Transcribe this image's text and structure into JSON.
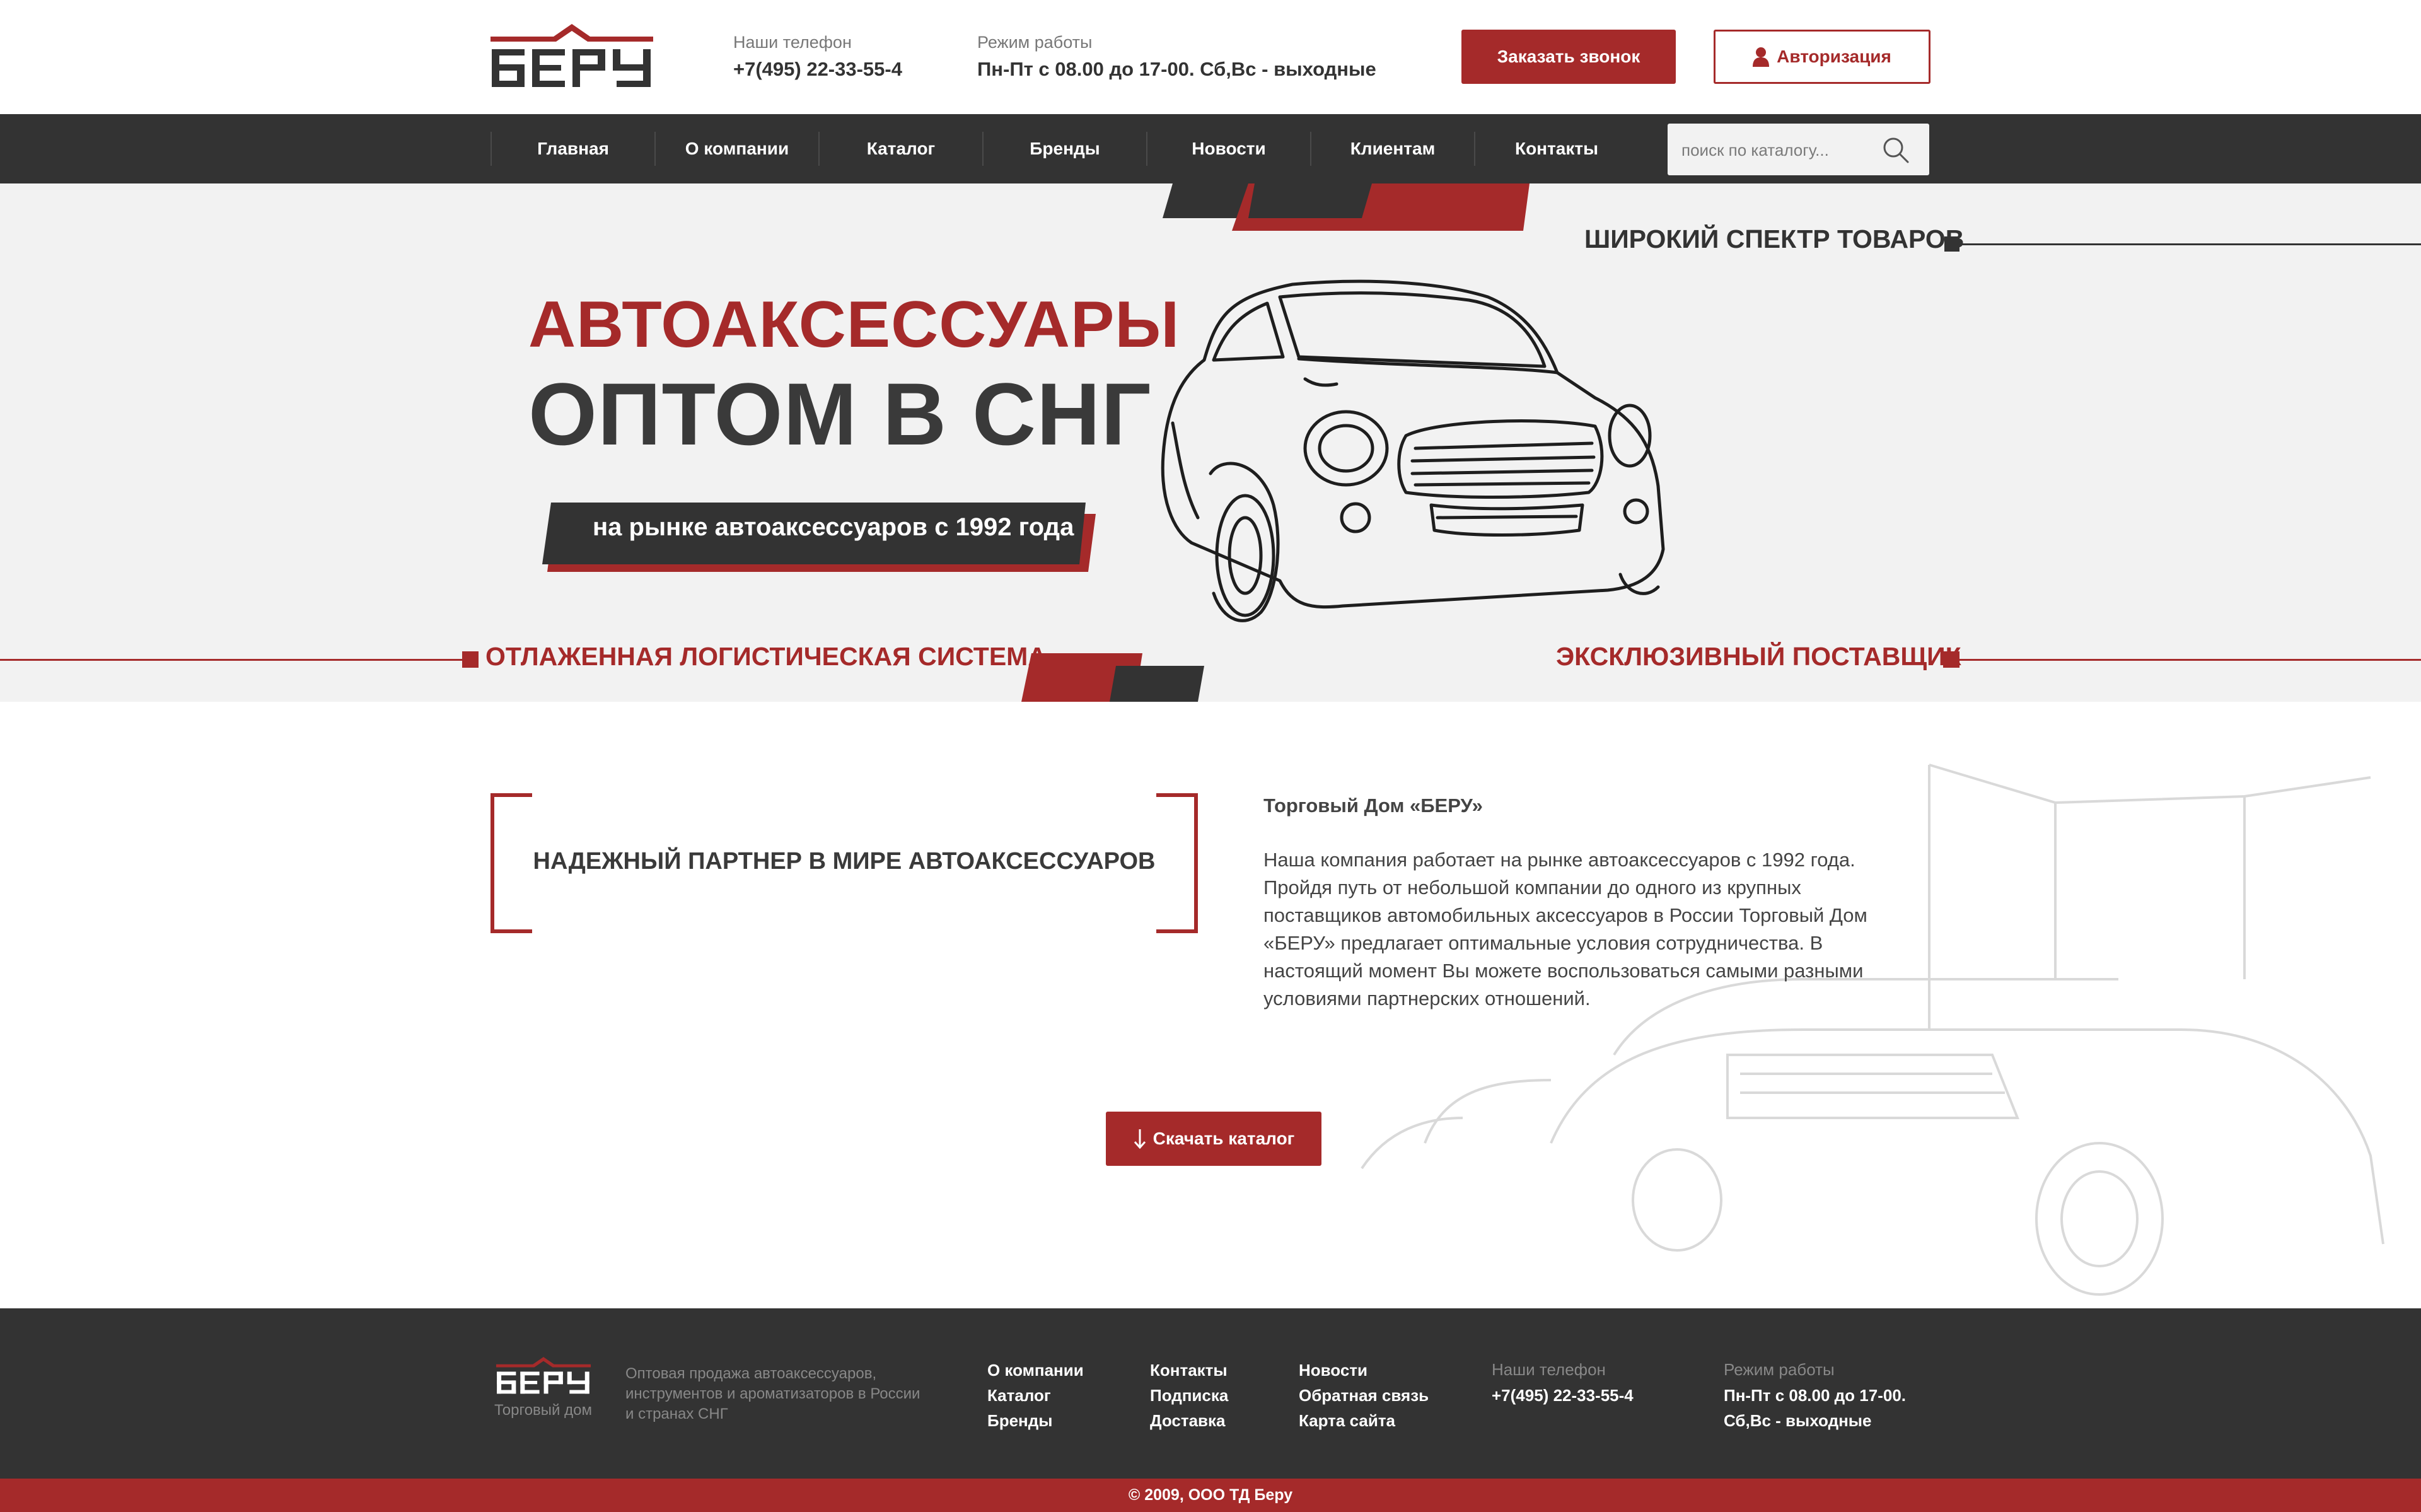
{
  "header": {
    "logo_text": "БЕРУ",
    "phone_label": "Наши телефон",
    "phone_value": "+7(495) 22-33-55-4",
    "hours_label": "Режим работы",
    "hours_value": "Пн-Пт с 08.00 до 17-00. Сб,Вс - выходные",
    "callback_button": "Заказать звонок",
    "login_button": "Авторизация"
  },
  "nav": {
    "items": [
      "Главная",
      "О компании",
      "Каталог",
      "Бренды",
      "Новости",
      "Клиентам",
      "Контакты"
    ],
    "search_placeholder": "поиск по каталогу..."
  },
  "hero": {
    "title_line1": "АВТОАКСЕССУАРЫ",
    "title_line2": "ОПТОМ В СНГ",
    "ribbon": "на рынке автоаксессуаров с 1992 года",
    "tag_wide_range": "ШИРОКИЙ СПЕКТР ТОВАРОВ",
    "tag_logistics": "ОТЛАЖЕННАЯ ЛОГИСТИЧЕСКАЯ СИСТЕМА",
    "tag_exclusive": "ЭКСКЛЮЗИВНЫЙ ПОСТАВЩИК"
  },
  "about": {
    "slogan": "НАДЕЖНЫЙ ПАРТНЕР В МИРЕ АВТОАКСЕССУАРОВ",
    "title": "Торговый Дом «БЕРУ»",
    "text": "Наша компания работает на рынке автоаксессуаров с 1992 года. Пройдя путь от небольшой компании до одного из крупных поставщиков автомобильных аксессуаров  в России Торговый Дом «БЕРУ» предлагает оптимальные условия сотрудничества. В настоящий момент Вы можете воспользоваться самыми разными  условиями партнерских отношений.",
    "download_button": "Скачать каталог"
  },
  "footer": {
    "logo_text": "БЕРУ",
    "logo_caption": "Торговый дом",
    "description": "Оптовая продажа автоаксессуаров, инструментов и ароматизаторов в России и странах СНГ",
    "col1": [
      "О компании",
      "Каталог",
      "Бренды"
    ],
    "col2": [
      "Контакты",
      "Подписка",
      "Доставка"
    ],
    "col3": [
      "Новости",
      "Обратная связь",
      "Карта сайта"
    ],
    "phone_label": "Наши телефон",
    "phone_value": "+7(495) 22-33-55-4",
    "hours_label": "Режим работы",
    "hours_line1": "Пн-Пт с 08.00 до 17-00.",
    "hours_line2": "Сб,Вс - выходные",
    "copyright": "© 2009, ООО ТД Беру"
  },
  "colors": {
    "accent": "#a52a2a",
    "dark": "#333333",
    "hero_bg": "#f2f2f2"
  },
  "icons": [
    "user-icon",
    "search-icon",
    "arrow-down-icon",
    "car-illustration",
    "logo-mark"
  ]
}
